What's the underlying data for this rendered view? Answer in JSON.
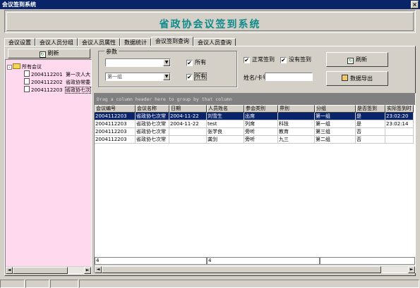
{
  "window": {
    "title": "会议签到系统",
    "close_glyph": "×"
  },
  "banner": {
    "title": "省政协会议签到系统"
  },
  "tabs": [
    "会议设置",
    "会议人员分组",
    "会议人员属性",
    "数据统计",
    "会议签到查询",
    "会议人员查询"
  ],
  "active_tab_index": 4,
  "tree_panel": {
    "refresh_label": "刷新",
    "root_label": "所有会议",
    "expander": "-",
    "items": [
      {
        "id": "2004112201",
        "name": "第一次人大"
      },
      {
        "id": "2004112202",
        "name": "省政协常委"
      },
      {
        "id": "2004112203",
        "name": "省政协七次"
      }
    ]
  },
  "filters": {
    "group_label": "参数",
    "combo1_value": "",
    "combo2_value": "第一组",
    "all1_label": "所有",
    "all1_checked": true,
    "all2_label": "所有",
    "all2_checked": true,
    "normal_label": "正常签到",
    "normal_checked": true,
    "not_signed_label": "没有签到",
    "not_signed_checked": true,
    "name_card_label": "姓名/卡号",
    "name_card_value": "",
    "refresh_label": "刷新",
    "export_label": "数据导出"
  },
  "grid": {
    "group_hint": "Drag a column header here to group by that column",
    "columns": [
      "会议编号",
      "会议名称",
      "日期",
      "人员姓名",
      "参会类别",
      "界别",
      "分组",
      "是否签到",
      "实际签到时"
    ],
    "rows": [
      [
        "2004112203",
        "省政协七次常",
        "2004-11-22",
        "刘雪生",
        "出席",
        "",
        "第一组",
        "是",
        "23:02:20"
      ],
      [
        "2004112203",
        "省政协七次常",
        "2004-11-22",
        "test",
        "列席",
        "科技",
        "第一组",
        "是",
        "23:02:14"
      ],
      [
        "2004112203",
        "省政协七次常",
        "",
        "张学良",
        "旁听",
        "教育",
        "第三组",
        "否",
        ""
      ],
      [
        "2004112203",
        "省政协七次常",
        "",
        "龚剑",
        "旁听",
        "九三",
        "第二组",
        "否",
        ""
      ]
    ],
    "selected_row": 0,
    "footer": [
      "4",
      "4"
    ]
  },
  "scroll": {
    "left": "◄",
    "right": "►"
  }
}
